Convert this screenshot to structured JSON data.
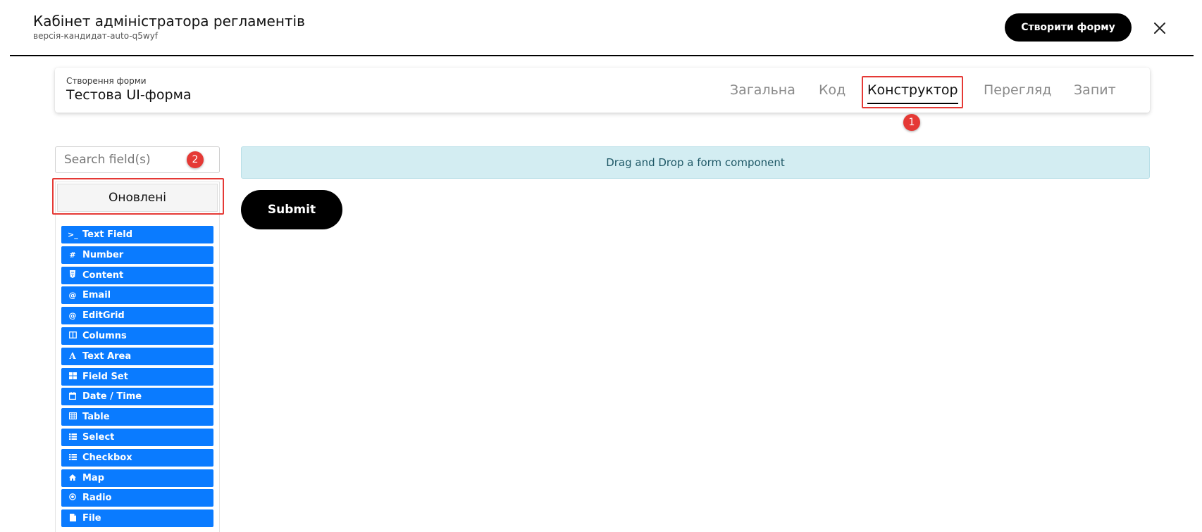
{
  "header": {
    "title": "Кабінет адміністратора регламентів",
    "version": "версія-кандидат-auto-q5wyf",
    "create_button": "Створити форму",
    "close_icon": "close-icon"
  },
  "form": {
    "eyebrow": "Створення форми",
    "name": "Тестова UI-форма"
  },
  "tabs": [
    {
      "label": "Загальна",
      "active": false
    },
    {
      "label": "Код",
      "active": false
    },
    {
      "label": "Конструктор",
      "active": true
    },
    {
      "label": "Перегляд",
      "active": false
    },
    {
      "label": "Запит",
      "active": false
    }
  ],
  "annotations": [
    {
      "label": "1",
      "color": "#e53935"
    },
    {
      "label": "2",
      "color": "#e53935"
    }
  ],
  "sidebar": {
    "search_placeholder": "Search field(s)",
    "group_label": "Оновлені",
    "components": [
      {
        "label": "Text Field",
        "icon": "terminal-icon"
      },
      {
        "label": "Number",
        "icon": "hash-icon"
      },
      {
        "label": "Content",
        "icon": "html5-icon"
      },
      {
        "label": "Email",
        "icon": "at-icon"
      },
      {
        "label": "EditGrid",
        "icon": "at-icon"
      },
      {
        "label": "Columns",
        "icon": "columns-icon"
      },
      {
        "label": "Text Area",
        "icon": "font-icon"
      },
      {
        "label": "Field Set",
        "icon": "th-large-icon"
      },
      {
        "label": "Date / Time",
        "icon": "calendar-icon"
      },
      {
        "label": "Table",
        "icon": "table-icon"
      },
      {
        "label": "Select",
        "icon": "list-icon"
      },
      {
        "label": "Checkbox",
        "icon": "list-icon"
      },
      {
        "label": "Map",
        "icon": "home-icon"
      },
      {
        "label": "Radio",
        "icon": "dot-circle-icon"
      },
      {
        "label": "File",
        "icon": "file-icon"
      }
    ]
  },
  "canvas": {
    "drop_hint": "Drag and Drop a form component",
    "submit_label": "Submit"
  },
  "colors": {
    "component_bg": "#0a7bff",
    "drop_zone_bg": "#d3edf2",
    "annotation_red": "#e53935",
    "primary_button": "#000000"
  }
}
